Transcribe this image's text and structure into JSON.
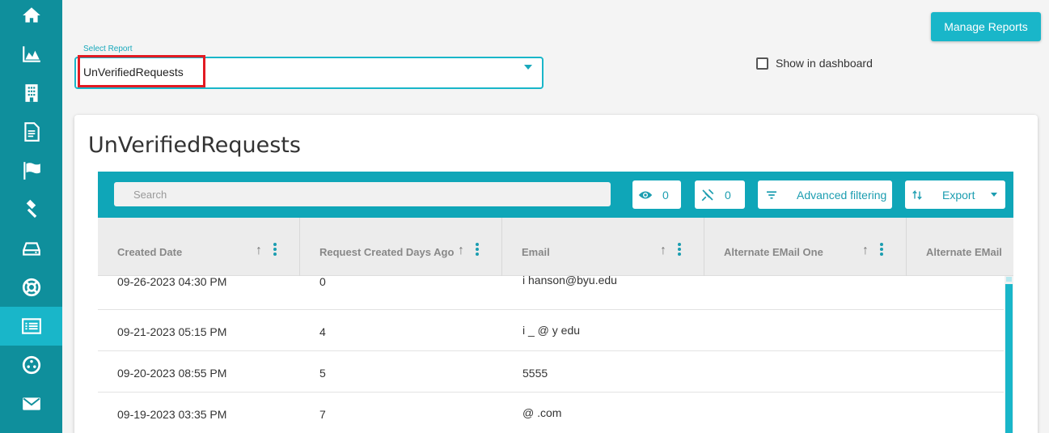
{
  "sidebar": {
    "items": [
      {
        "icon": "home-icon",
        "active": false
      },
      {
        "icon": "chart-icon",
        "active": false
      },
      {
        "icon": "building-icon",
        "active": false
      },
      {
        "icon": "document-icon",
        "active": false
      },
      {
        "icon": "flag-icon",
        "active": false
      },
      {
        "icon": "gavel-icon",
        "active": false
      },
      {
        "icon": "drive-icon",
        "active": false
      },
      {
        "icon": "lifebuoy-icon",
        "active": false
      },
      {
        "icon": "report-list-icon",
        "active": true
      },
      {
        "icon": "network-icon",
        "active": false
      },
      {
        "icon": "mail-icon",
        "active": false
      }
    ],
    "bg_color": "#0f8f9c",
    "active_color": "#19b6c9"
  },
  "header": {
    "manage_reports_label": "Manage Reports",
    "select_report_label": "Select Report",
    "selected_report": "UnVerifiedRequests",
    "show_in_dashboard_label": "Show in dashboard"
  },
  "card": {
    "title": "UnVerifiedRequests"
  },
  "toolbar": {
    "search_placeholder": "Search",
    "visible_count": "0",
    "pinned_count": "0",
    "advanced_filtering_label": "Advanced filtering",
    "export_label": "Export"
  },
  "columns": [
    "Created Date",
    "Request Created Days Ago",
    "Email",
    "Alternate EMail One",
    "Alternate EMail"
  ],
  "rows": [
    {
      "created": "09-26-2023 04:30 PM",
      "days": "0",
      "email": "i     hanson@byu.edu"
    },
    {
      "created": "09-21-2023 05:15 PM",
      "days": "4",
      "email": "i   _     @ y edu"
    },
    {
      "created": "09-20-2023 08:55 PM",
      "days": "5",
      "email": "5555"
    },
    {
      "created": "09-19-2023 03:35 PM",
      "days": "7",
      "email": "       @        .com"
    }
  ],
  "colors": {
    "accent": "#19b6c9",
    "toolbar": "#0fa6b8",
    "highlight": "#e21b23"
  }
}
